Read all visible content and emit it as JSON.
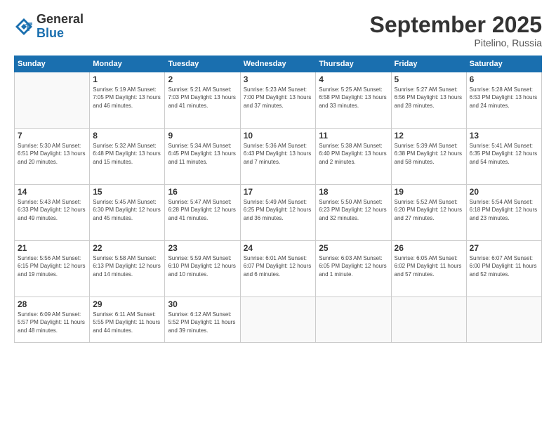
{
  "logo": {
    "general": "General",
    "blue": "Blue"
  },
  "title": "September 2025",
  "location": "Pitelino, Russia",
  "days_header": [
    "Sunday",
    "Monday",
    "Tuesday",
    "Wednesday",
    "Thursday",
    "Friday",
    "Saturday"
  ],
  "weeks": [
    [
      {
        "day": "",
        "info": ""
      },
      {
        "day": "1",
        "info": "Sunrise: 5:19 AM\nSunset: 7:05 PM\nDaylight: 13 hours\nand 46 minutes."
      },
      {
        "day": "2",
        "info": "Sunrise: 5:21 AM\nSunset: 7:03 PM\nDaylight: 13 hours\nand 41 minutes."
      },
      {
        "day": "3",
        "info": "Sunrise: 5:23 AM\nSunset: 7:00 PM\nDaylight: 13 hours\nand 37 minutes."
      },
      {
        "day": "4",
        "info": "Sunrise: 5:25 AM\nSunset: 6:58 PM\nDaylight: 13 hours\nand 33 minutes."
      },
      {
        "day": "5",
        "info": "Sunrise: 5:27 AM\nSunset: 6:56 PM\nDaylight: 13 hours\nand 28 minutes."
      },
      {
        "day": "6",
        "info": "Sunrise: 5:28 AM\nSunset: 6:53 PM\nDaylight: 13 hours\nand 24 minutes."
      }
    ],
    [
      {
        "day": "7",
        "info": "Sunrise: 5:30 AM\nSunset: 6:51 PM\nDaylight: 13 hours\nand 20 minutes."
      },
      {
        "day": "8",
        "info": "Sunrise: 5:32 AM\nSunset: 6:48 PM\nDaylight: 13 hours\nand 15 minutes."
      },
      {
        "day": "9",
        "info": "Sunrise: 5:34 AM\nSunset: 6:45 PM\nDaylight: 13 hours\nand 11 minutes."
      },
      {
        "day": "10",
        "info": "Sunrise: 5:36 AM\nSunset: 6:43 PM\nDaylight: 13 hours\nand 7 minutes."
      },
      {
        "day": "11",
        "info": "Sunrise: 5:38 AM\nSunset: 6:40 PM\nDaylight: 13 hours\nand 2 minutes."
      },
      {
        "day": "12",
        "info": "Sunrise: 5:39 AM\nSunset: 6:38 PM\nDaylight: 12 hours\nand 58 minutes."
      },
      {
        "day": "13",
        "info": "Sunrise: 5:41 AM\nSunset: 6:35 PM\nDaylight: 12 hours\nand 54 minutes."
      }
    ],
    [
      {
        "day": "14",
        "info": "Sunrise: 5:43 AM\nSunset: 6:33 PM\nDaylight: 12 hours\nand 49 minutes."
      },
      {
        "day": "15",
        "info": "Sunrise: 5:45 AM\nSunset: 6:30 PM\nDaylight: 12 hours\nand 45 minutes."
      },
      {
        "day": "16",
        "info": "Sunrise: 5:47 AM\nSunset: 6:28 PM\nDaylight: 12 hours\nand 41 minutes."
      },
      {
        "day": "17",
        "info": "Sunrise: 5:49 AM\nSunset: 6:25 PM\nDaylight: 12 hours\nand 36 minutes."
      },
      {
        "day": "18",
        "info": "Sunrise: 5:50 AM\nSunset: 6:23 PM\nDaylight: 12 hours\nand 32 minutes."
      },
      {
        "day": "19",
        "info": "Sunrise: 5:52 AM\nSunset: 6:20 PM\nDaylight: 12 hours\nand 27 minutes."
      },
      {
        "day": "20",
        "info": "Sunrise: 5:54 AM\nSunset: 6:18 PM\nDaylight: 12 hours\nand 23 minutes."
      }
    ],
    [
      {
        "day": "21",
        "info": "Sunrise: 5:56 AM\nSunset: 6:15 PM\nDaylight: 12 hours\nand 19 minutes."
      },
      {
        "day": "22",
        "info": "Sunrise: 5:58 AM\nSunset: 6:13 PM\nDaylight: 12 hours\nand 14 minutes."
      },
      {
        "day": "23",
        "info": "Sunrise: 5:59 AM\nSunset: 6:10 PM\nDaylight: 12 hours\nand 10 minutes."
      },
      {
        "day": "24",
        "info": "Sunrise: 6:01 AM\nSunset: 6:07 PM\nDaylight: 12 hours\nand 6 minutes."
      },
      {
        "day": "25",
        "info": "Sunrise: 6:03 AM\nSunset: 6:05 PM\nDaylight: 12 hours\nand 1 minute."
      },
      {
        "day": "26",
        "info": "Sunrise: 6:05 AM\nSunset: 6:02 PM\nDaylight: 11 hours\nand 57 minutes."
      },
      {
        "day": "27",
        "info": "Sunrise: 6:07 AM\nSunset: 6:00 PM\nDaylight: 11 hours\nand 52 minutes."
      }
    ],
    [
      {
        "day": "28",
        "info": "Sunrise: 6:09 AM\nSunset: 5:57 PM\nDaylight: 11 hours\nand 48 minutes."
      },
      {
        "day": "29",
        "info": "Sunrise: 6:11 AM\nSunset: 5:55 PM\nDaylight: 11 hours\nand 44 minutes."
      },
      {
        "day": "30",
        "info": "Sunrise: 6:12 AM\nSunset: 5:52 PM\nDaylight: 11 hours\nand 39 minutes."
      },
      {
        "day": "",
        "info": ""
      },
      {
        "day": "",
        "info": ""
      },
      {
        "day": "",
        "info": ""
      },
      {
        "day": "",
        "info": ""
      }
    ]
  ]
}
